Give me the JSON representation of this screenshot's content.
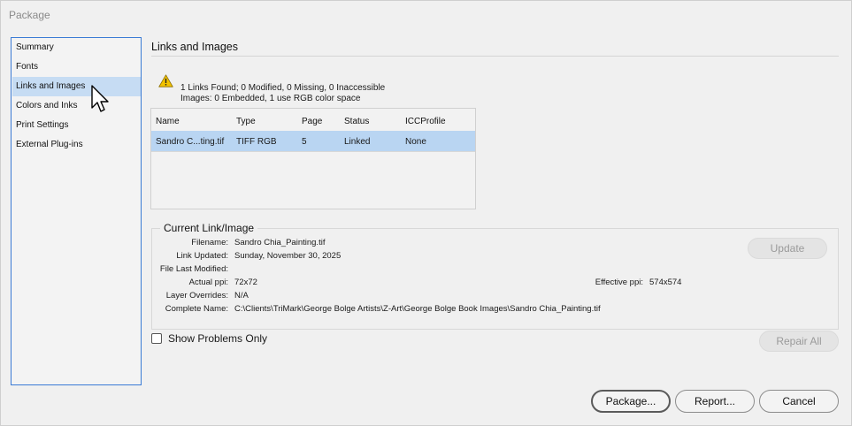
{
  "window": {
    "title": "Package"
  },
  "sidebar": {
    "items": [
      {
        "label": "Summary"
      },
      {
        "label": "Fonts"
      },
      {
        "label": "Links and Images"
      },
      {
        "label": "Colors and Inks"
      },
      {
        "label": "Print Settings"
      },
      {
        "label": "External Plug-ins"
      }
    ],
    "selected": "Links and Images"
  },
  "main": {
    "title": "Links and Images",
    "summary_line1": "1 Links Found; 0 Modified, 0 Missing, 0 Inaccessible",
    "summary_line2": "Images: 0 Embedded, 1 use RGB color space",
    "table": {
      "headers": [
        "Name",
        "Type",
        "Page",
        "Status",
        "ICCProfile"
      ],
      "rows": [
        [
          "Sandro C...ting.tif",
          "TIFF RGB",
          "5",
          "Linked",
          "None"
        ]
      ]
    },
    "current": {
      "legend": "Current Link/Image",
      "filename_label": "Filename:",
      "filename": "Sandro Chia_Painting.tif",
      "updated_label": "Link Updated:",
      "updated": "Sunday, November 30, 2025",
      "modified_label": "File Last Modified:",
      "modified": "",
      "ppi_label": "Actual ppi:",
      "ppi": "72x72",
      "eff_label": "Effective ppi:",
      "eff": "574x574",
      "overrides_label": "Layer Overrides:",
      "overrides": "N/A",
      "name_label": "Complete Name:",
      "name": "C:\\Clients\\TriMark\\George Bolge Artists\\Z-Art\\George Bolge Book Images\\Sandro Chia_Painting.tif"
    },
    "update_label": "Update",
    "show_problems_label": "Show Problems Only",
    "repair_label": "Repair All"
  },
  "footer": {
    "package_label": "Package...",
    "report_label": "Report...",
    "cancel_label": "Cancel"
  },
  "colors": {
    "selection": "#c6dcf3",
    "row_selection": "#b9d5f2",
    "sidebar_border": "#3a7bd5",
    "warning": "#f2c200"
  },
  "icons": [
    "warning-icon",
    "cursor-pointer-icon"
  ]
}
